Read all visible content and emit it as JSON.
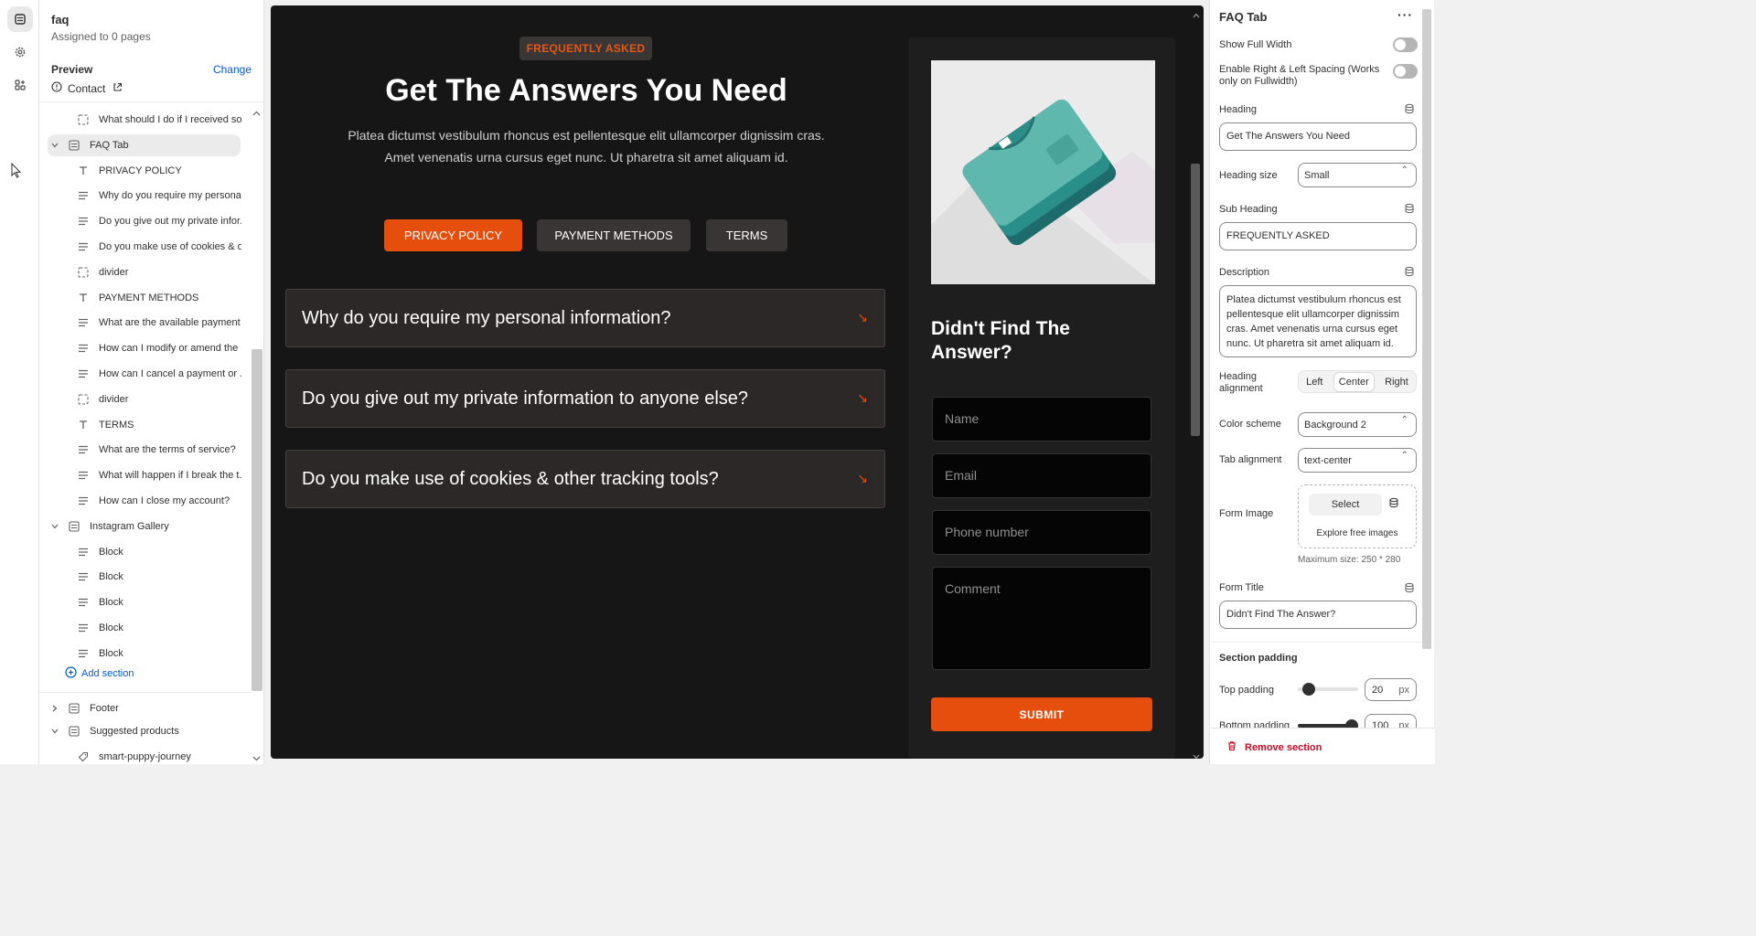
{
  "left": {
    "title": "faq",
    "subtitle": "Assigned to 0 pages",
    "preview_label": "Preview",
    "change_label": "Change",
    "contact_label": "Contact",
    "tree": [
      {
        "label": "What should I do if I received so...",
        "icon": "dashed-square-icon",
        "indent": 2
      },
      {
        "label": "FAQ Tab",
        "icon": "section-icon",
        "indent": 1,
        "selected": true
      },
      {
        "label": "PRIVACY POLICY",
        "icon": "text-icon",
        "indent": 2
      },
      {
        "label": "Why do you require my persona...",
        "icon": "lines-icon",
        "indent": 2
      },
      {
        "label": "Do you give out my private infor...",
        "icon": "lines-icon",
        "indent": 2
      },
      {
        "label": "Do you make use of cookies & o...",
        "icon": "lines-icon",
        "indent": 2
      },
      {
        "label": "divider",
        "icon": "dashed-square-icon",
        "indent": 2
      },
      {
        "label": "PAYMENT METHODS",
        "icon": "text-icon",
        "indent": 2
      },
      {
        "label": "What are the available payment ...",
        "icon": "lines-icon",
        "indent": 2
      },
      {
        "label": "How can I modify or amend the i...",
        "icon": "lines-icon",
        "indent": 2
      },
      {
        "label": "How can I cancel a payment or ...",
        "icon": "lines-icon",
        "indent": 2
      },
      {
        "label": "divider",
        "icon": "dashed-square-icon",
        "indent": 2
      },
      {
        "label": "TERMS",
        "icon": "text-icon",
        "indent": 2
      },
      {
        "label": "What are the terms of service?",
        "icon": "lines-icon",
        "indent": 2
      },
      {
        "label": "What will happen if I break the t...",
        "icon": "lines-icon",
        "indent": 2
      },
      {
        "label": "How can I close my account?",
        "icon": "lines-icon",
        "indent": 2
      },
      {
        "label": "Instagram Gallery",
        "icon": "section-icon",
        "indent": 1
      },
      {
        "label": "Block",
        "icon": "lines-icon",
        "indent": 2
      },
      {
        "label": "Block",
        "icon": "lines-icon",
        "indent": 2
      },
      {
        "label": "Block",
        "icon": "lines-icon",
        "indent": 2
      },
      {
        "label": "Block",
        "icon": "lines-icon",
        "indent": 2
      },
      {
        "label": "Block",
        "icon": "lines-icon",
        "indent": 2
      }
    ],
    "add_section": "Add section",
    "footer_label": "Footer",
    "suggested_label": "Suggested products",
    "suggested_child": "smart-puppy-journey"
  },
  "canvas": {
    "badge": "FREQUENTLY ASKED",
    "heading": "Get The Answers You Need",
    "description": "Platea dictumst vestibulum rhoncus est pellentesque elit ullamcorper dignissim cras. Amet venenatis urna cursus eget nunc. Ut pharetra sit amet aliquam id.",
    "tabs": [
      "PRIVACY POLICY",
      "PAYMENT METHODS",
      "TERMS"
    ],
    "questions": [
      "Why do you require my personal information?",
      "Do you give out my private information to anyone else?",
      "Do you make use of cookies & other tracking tools?"
    ],
    "form_title": "Didn't Find The Answer?",
    "fields": {
      "name": "Name",
      "email": "Email",
      "phone": "Phone number",
      "comment": "Comment"
    },
    "submit": "SUBMIT",
    "accent": "#e54e0d"
  },
  "right": {
    "title": "FAQ Tab",
    "show_full_width": "Show Full Width",
    "enable_spacing": "Enable Right & Left Spacing (Works only on Fullwidth)",
    "heading_label": "Heading",
    "heading_value": "Get The Answers You Need",
    "heading_size_label": "Heading size",
    "heading_size_value": "Small",
    "subheading_label": "Sub Heading",
    "subheading_value": "FREQUENTLY ASKED",
    "description_label": "Description",
    "description_value": "Platea dictumst vestibulum rhoncus est pellentesque elit ullamcorper dignissim cras. Amet venenatis urna cursus eget nunc. Ut pharetra sit amet aliquam id.",
    "heading_alignment_label": "Heading alignment",
    "align_options": [
      "Left",
      "Center",
      "Right"
    ],
    "color_scheme_label": "Color scheme",
    "color_scheme_value": "Background 2",
    "tab_alignment_label": "Tab alignment",
    "tab_alignment_value": "text-center",
    "form_image_label": "Form Image",
    "select_label": "Select",
    "explore_label": "Explore free images",
    "max_size": "Maximum size: 250 * 280",
    "form_title_label": "Form Title",
    "form_title_value": "Didn't Find The Answer?",
    "section_padding": "Section padding",
    "top_padding_label": "Top padding",
    "top_padding_value": "20",
    "bottom_padding_label": "Bottom padding",
    "bottom_padding_value": "100",
    "unit": "px",
    "remove_section": "Remove section"
  }
}
